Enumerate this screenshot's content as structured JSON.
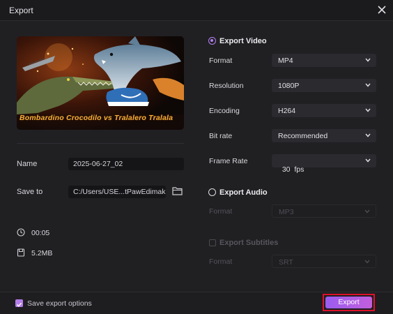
{
  "window": {
    "title": "Export"
  },
  "preview": {
    "caption": "Bombardino Crocodilo vs Tralalero Tralala"
  },
  "left": {
    "name_label": "Name",
    "name_value": "2025-06-27_02",
    "save_label": "Save to",
    "save_value": "C:/Users/USE...tPawEdimakor",
    "duration": "00:05",
    "size": "5.2MB"
  },
  "video": {
    "heading": "Export Video",
    "selected": true,
    "rows": [
      {
        "label": "Format",
        "value": "MP4"
      },
      {
        "label": "Resolution",
        "value": "1080P"
      },
      {
        "label": "Encoding",
        "value": "H264"
      },
      {
        "label": "Bit rate",
        "value": "Recommended"
      },
      {
        "label": "Frame Rate",
        "value": "30  fps"
      }
    ]
  },
  "audio": {
    "heading": "Export Audio",
    "selected": false,
    "format_label": "Format",
    "format_value": "MP3"
  },
  "subtitles": {
    "heading": "Export Subtitles",
    "checked": false,
    "format_label": "Format",
    "format_value": "SRT"
  },
  "footer": {
    "save_options_label": "Save export options",
    "save_options_checked": true,
    "export_label": "Export"
  },
  "colors": {
    "accent": "#b480f0",
    "highlight": "#e0102a",
    "background": "#202023"
  }
}
